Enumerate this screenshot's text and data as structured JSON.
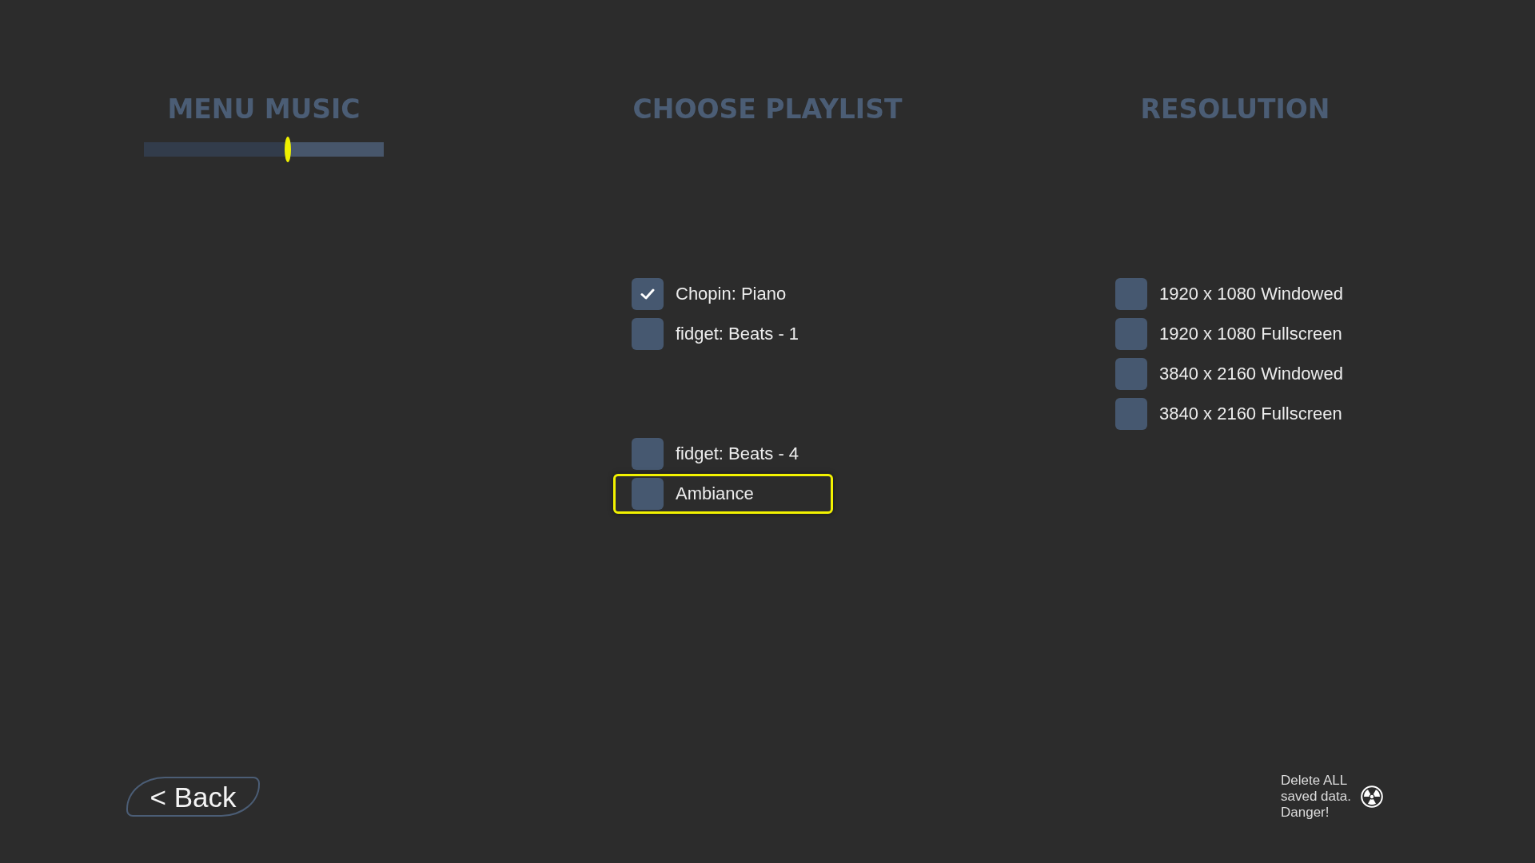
{
  "menu_music": {
    "title": "MENU MUSIC",
    "level": 0.6
  },
  "playlist": {
    "title": "CHOOSE PLAYLIST",
    "options": [
      {
        "label": "Chopin: Piano",
        "checked": true,
        "focused": false
      },
      {
        "label": "fidget: Beats - 1",
        "checked": false,
        "focused": false
      },
      {
        "label": "fidget: Beats - 4",
        "checked": false,
        "focused": false
      },
      {
        "label": "Ambiance",
        "checked": false,
        "focused": true
      }
    ]
  },
  "resolution": {
    "title": "RESOLUTION",
    "options": [
      {
        "label": "1920 x 1080 Windowed",
        "checked": false,
        "focused": false
      },
      {
        "label": "1920 x 1080 Fullscreen",
        "checked": false,
        "focused": false
      },
      {
        "label": "3840 x 2160 Windowed",
        "checked": false,
        "focused": false
      },
      {
        "label": "3840 x 2160 Fullscreen",
        "checked": false,
        "focused": false
      }
    ]
  },
  "back_button": {
    "label": "< Back"
  },
  "delete_data": {
    "label": "Delete ALL saved data. Danger!"
  }
}
